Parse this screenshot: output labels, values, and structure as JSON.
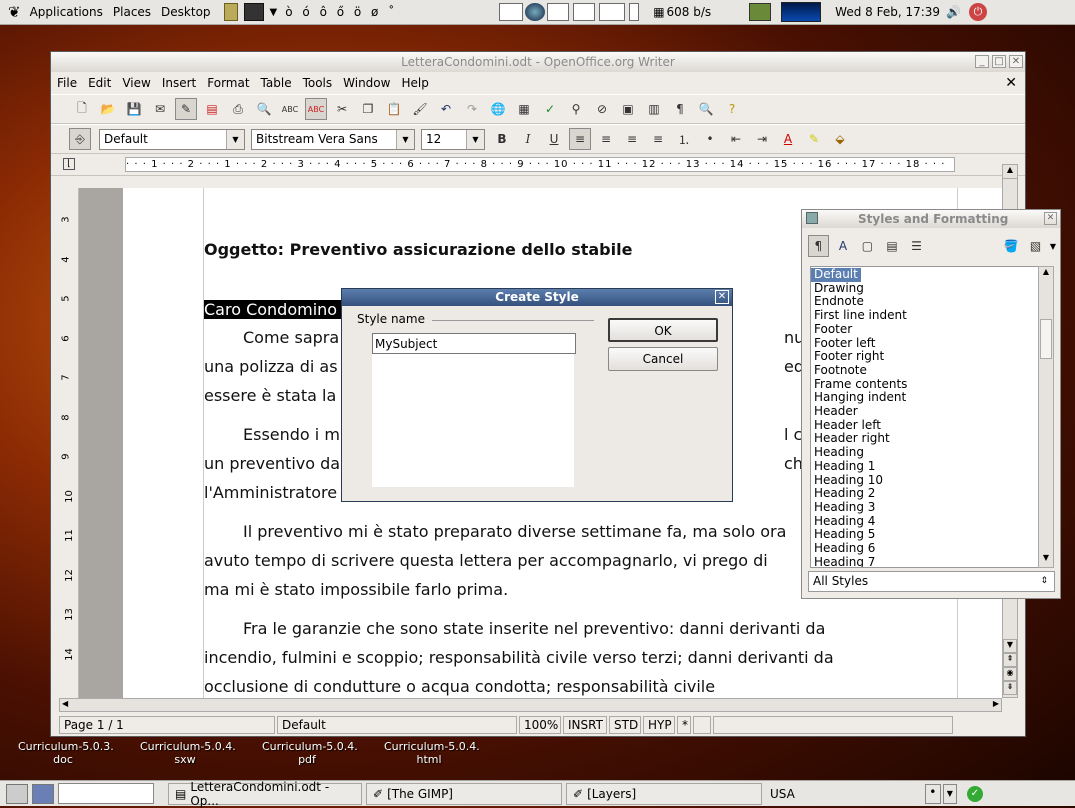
{
  "top_panel": {
    "menus": [
      "Applications",
      "Places",
      "Desktop"
    ],
    "chars": "ò ó ô ő ö ø ˚",
    "net_speed": "608 b/s",
    "clock": "Wed  8 Feb, 17:39"
  },
  "desktop_icons": [
    {
      "label": "Curriculum-5.0.3.\ndoc"
    },
    {
      "label": "Curriculum-5.0.4.\nsxw"
    },
    {
      "label": "Curriculum-5.0.4.\npdf"
    },
    {
      "label": "Curriculum-5.0.4.\nhtml"
    }
  ],
  "writer": {
    "title": "LetteraCondomini.odt - OpenOffice.org Writer",
    "menu": [
      "File",
      "Edit",
      "View",
      "Insert",
      "Format",
      "Table",
      "Tools",
      "Window",
      "Help"
    ],
    "para_style": "Default",
    "font_name": "Bitstream Vera Sans",
    "font_size": "12",
    "ruler_text": "· · · 1 · · · 2 · · · 1 · · · 2 · · · 3 · · · 4 · · · 5 · · · 6 · · · 7 · · · 8 · · · 9 · · · 10 · · · 11 · · · 12 · · · 13 · · · 14 · · · 15 · · · 16 · · · 17 · · · 18 · · ·",
    "vruler_numbers": [
      "3",
      "4",
      "5",
      "6",
      "7",
      "8",
      "9",
      "10",
      "11",
      "12",
      "13",
      "14"
    ],
    "document": {
      "subject": "Oggetto: Preventivo assicurazione dello stabile",
      "greeting": "Caro Condomino",
      "lines": [
        "Come sapra",
        "una polizza di as",
        "essere è stata la",
        "Essendo i m",
        "un preventivo da",
        "l'Amministratore",
        "Il preventivo mi è stato preparato diverse settimane fa, ma solo ora",
        "avuto tempo di scrivere questa lettera per accompagnarlo, vi prego di",
        "ma mi è stato impossibile farlo prima.",
        "Fra le garanzie che sono state inserite nel preventivo: danni derivanti da",
        "incendio, fulmini e scoppio; responsabilità civile verso terzi; danni derivanti da",
        "occlusione di condutture o acqua condotta; responsabilità civile"
      ],
      "right_fragments": [
        "nuovan",
        "edentem",
        "l caso d",
        "che"
      ]
    },
    "status": {
      "page": "Page 1 / 1",
      "style": "Default",
      "zoom": "100%",
      "insert": "INSRT",
      "std": "STD",
      "hyp": "HYP",
      "mod": "*"
    }
  },
  "dialog": {
    "title": "Create Style",
    "group_label": "Style name",
    "input_value": "MySubject",
    "ok": "OK",
    "cancel": "Cancel"
  },
  "styles_panel": {
    "title": "Styles and Formatting",
    "items": [
      "Default",
      "Drawing",
      "Endnote",
      "First line indent",
      "Footer",
      "Footer left",
      "Footer right",
      "Footnote",
      "Frame contents",
      "Hanging indent",
      "Header",
      "Header left",
      "Header right",
      "Heading",
      "Heading 1",
      "Heading 10",
      "Heading 2",
      "Heading 3",
      "Heading 4",
      "Heading 5",
      "Heading 6",
      "Heading 7"
    ],
    "selected_index": 0,
    "filter": "All Styles"
  },
  "taskbar": {
    "tasks": [
      "LetteraCondomini.odt - Op...",
      "[The GIMP]",
      "[Layers]"
    ],
    "keyboard": "USA"
  }
}
